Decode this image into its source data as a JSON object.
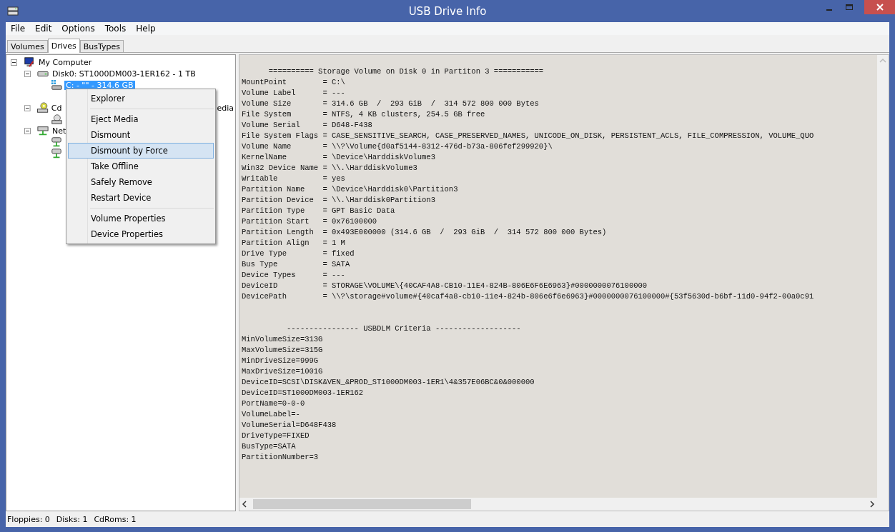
{
  "window": {
    "title": "USB Drive Info"
  },
  "menu_bar": [
    "File",
    "Edit",
    "Options",
    "Tools",
    "Help"
  ],
  "tabs": [
    {
      "label": "Volumes",
      "selected": false
    },
    {
      "label": "Drives",
      "selected": true
    },
    {
      "label": "BusTypes",
      "selected": false
    }
  ],
  "tree": [
    {
      "kind": "computer",
      "label": "My Computer",
      "expanded": true,
      "selected": false,
      "children": [
        {
          "kind": "disk",
          "label": "Disk0: ST1000DM003-1ER162 - 1 TB",
          "expanded": true,
          "selected": false,
          "children": [
            {
              "kind": "volume",
              "label": "C: - \"\" - 314.6 GB",
              "selected": true
            }
          ]
        },
        {
          "kind": "cdrom",
          "label": "Cd",
          "label_end": "edia",
          "expanded": true,
          "selected": false,
          "children": [
            {
              "kind": "cd_volume"
            }
          ]
        },
        {
          "kind": "network",
          "label": "Net",
          "expanded": true,
          "selected": false,
          "children": [
            {
              "kind": "network_drive"
            },
            {
              "kind": "network_drive"
            }
          ]
        }
      ]
    }
  ],
  "details": [
    {
      "heading": "      ========== Storage Volume on Disk 0 in Partiton 3 ===========",
      "lines": [
        "MountPoint        = C:\\",
        "Volume Label      = ---",
        "Volume Size       = 314.6 GB  /  293 GiB  /  314 572 800 000 Bytes",
        "File System       = NTFS, 4 KB clusters, 254.5 GB free",
        "Volume Serial     = D648-F438",
        "File System Flags = CASE_SENSITIVE_SEARCH, CASE_PRESERVED_NAMES, UNICODE_ON_DISK, PERSISTENT_ACLS, FILE_COMPRESSION, VOLUME_QUO",
        "Volume Name       = \\\\?\\Volume{d0af5144-8312-476d-b73a-806fef299920}\\",
        "KernelName        = \\Device\\HarddiskVolume3",
        "Win32 Device Name = \\\\.\\HarddiskVolume3",
        "Writable          = yes",
        "Partition Name    = \\Device\\Harddisk0\\Partition3",
        "Partition Device  = \\\\.\\Harddisk0Partition3",
        "Partition Type    = GPT Basic Data",
        "Partition Start   = 0x76100000",
        "Partition Length  = 0x493E000000 (314.6 GB  /  293 GiB  /  314 572 800 000 Bytes)",
        "Partition Align   = 1 M",
        "Drive Type        = fixed",
        "Bus Type          = SATA",
        "Device Types      = ---",
        "DeviceID          = STORAGE\\VOLUME\\{40CAF4A8-CB10-11E4-824B-806E6F6E6963}#0000000076100000",
        "DevicePath        = \\\\?\\storage#volume#{40caf4a8-cb10-11e4-824b-806e6f6e6963}#0000000076100000#{53f5630d-b6bf-11d0-94f2-00a0c91"
      ]
    },
    {
      "heading": "          ---------------- USBDLM Criteria -------------------",
      "lines": [
        "MinVolumeSize=313G",
        "MaxVolumeSize=315G",
        "MinDriveSize=999G",
        "MaxDriveSize=1001G",
        "DeviceID=SCSI\\DISK&VEN_&PROD_ST1000DM003-1ER1\\4&357E06BC&0&000000",
        "DeviceID=ST1000DM003-1ER162",
        "PortName=0-0-0",
        "VolumeLabel=-",
        "VolumeSerial=D648F438",
        "DriveType=FIXED",
        "BusType=SATA",
        "PartitionNumber=3"
      ]
    }
  ],
  "context_menu": [
    {
      "kind": "item",
      "label": "Explorer",
      "selected": false
    },
    {
      "kind": "separator"
    },
    {
      "kind": "item",
      "label": "Eject Media",
      "selected": false
    },
    {
      "kind": "item",
      "label": "Dismount",
      "selected": false
    },
    {
      "kind": "item",
      "label": "Dismount by Force",
      "selected": true
    },
    {
      "kind": "item",
      "label": "Take Offline",
      "selected": false
    },
    {
      "kind": "item",
      "label": "Safely Remove",
      "selected": false
    },
    {
      "kind": "item",
      "label": "Restart Device",
      "selected": false
    },
    {
      "kind": "separator"
    },
    {
      "kind": "item",
      "label": "Volume Properties",
      "selected": false
    },
    {
      "kind": "item",
      "label": "Device Properties",
      "selected": false
    }
  ],
  "status_bar": [
    "Floppies: 0",
    "Disks: 1",
    "CdRoms: 1"
  ]
}
